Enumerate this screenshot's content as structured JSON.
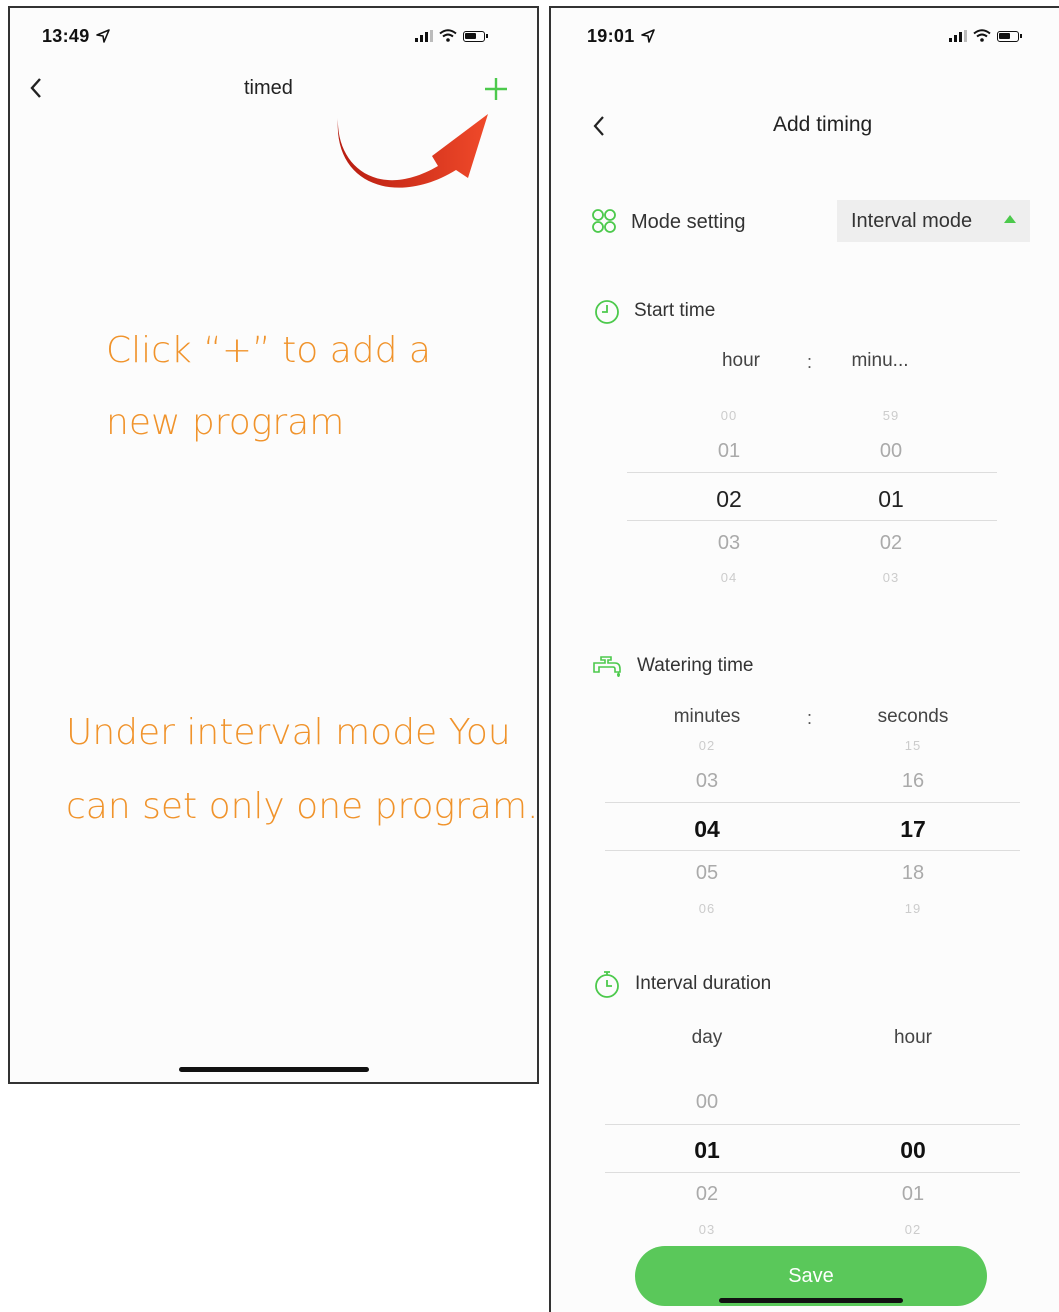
{
  "left": {
    "status_time": "13:49",
    "nav_title": "timed",
    "instruction_line1": "Click  “+” to add a",
    "instruction_line2": "new program",
    "note_line1": "Under interval mode You",
    "note_line2": "can set only one program."
  },
  "right": {
    "status_time": "19:01",
    "nav_title": "Add timing",
    "mode": {
      "label": "Mode setting",
      "value": "Interval mode"
    },
    "start_time": {
      "label": "Start time",
      "col1": "hour",
      "col2": "minu...",
      "separator": ":",
      "col1_values": [
        "00",
        "01",
        "02",
        "03",
        "04"
      ],
      "col2_values": [
        "59",
        "00",
        "01",
        "02",
        "03"
      ]
    },
    "watering_time": {
      "label": "Watering time",
      "col1": "minutes",
      "col2": "seconds",
      "separator": ":",
      "col1_values": [
        "02",
        "03",
        "04",
        "05",
        "06"
      ],
      "col2_values": [
        "15",
        "16",
        "17",
        "18",
        "19"
      ]
    },
    "interval_duration": {
      "label": "Interval duration",
      "col1": "day",
      "col2": "hour",
      "col1_values": [
        "00",
        "01",
        "02",
        "03"
      ],
      "col2_values": [
        "00",
        "01",
        "02"
      ]
    },
    "save_label": "Save"
  },
  "colors": {
    "accent_green": "#4cc94c",
    "annotation_orange": "#f0932b",
    "arrow_red": "#d92b1a"
  },
  "icons": [
    "location-arrow-icon",
    "signal-icon",
    "wifi-icon",
    "battery-icon",
    "back-chevron-icon",
    "plus-icon",
    "curved-arrow-icon",
    "mode-grid-icon",
    "clock-icon",
    "faucet-icon",
    "timer-icon"
  ]
}
